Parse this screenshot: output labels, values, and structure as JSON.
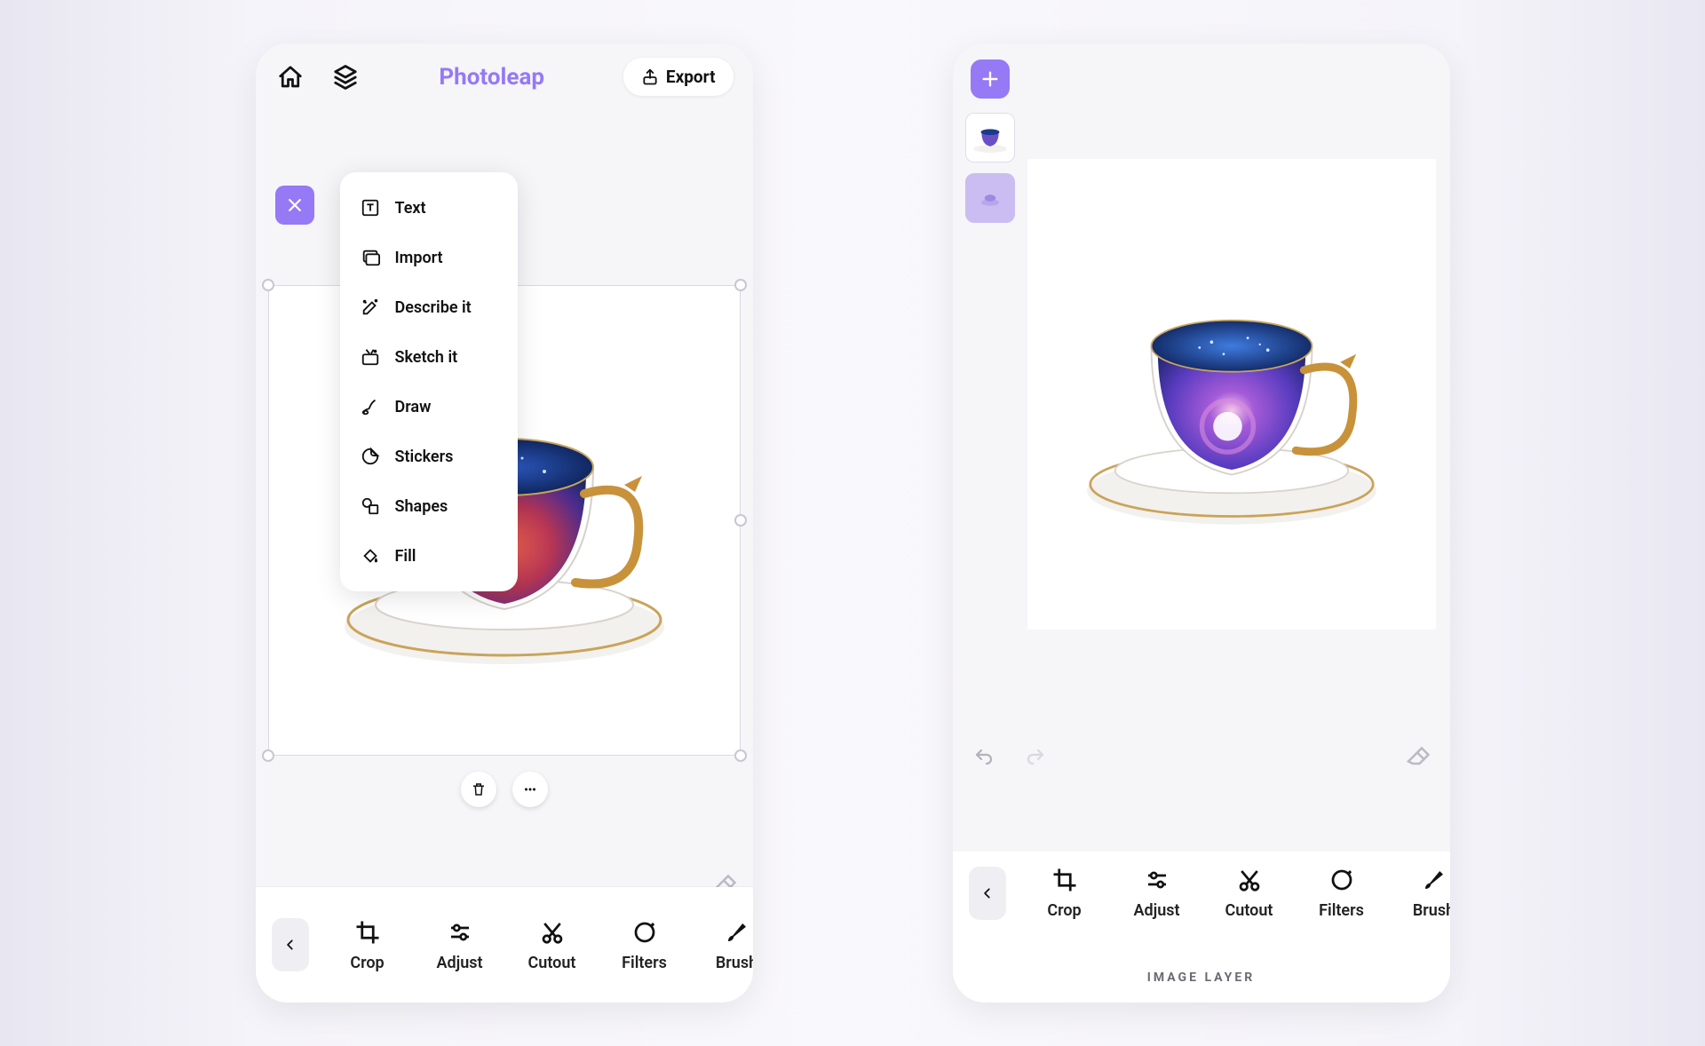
{
  "phone_a": {
    "brand": "Photoleap",
    "export_label": "Export",
    "menu": {
      "items": [
        {
          "label": "Text",
          "icon": "text-icon"
        },
        {
          "label": "Import",
          "icon": "import-icon"
        },
        {
          "label": "Describe it",
          "icon": "describe-icon"
        },
        {
          "label": "Sketch it",
          "icon": "sketch-icon"
        },
        {
          "label": "Draw",
          "icon": "draw-icon"
        },
        {
          "label": "Stickers",
          "icon": "stickers-icon"
        },
        {
          "label": "Shapes",
          "icon": "shapes-icon"
        },
        {
          "label": "Fill",
          "icon": "fill-icon"
        }
      ]
    },
    "tools": [
      {
        "label": "Crop"
      },
      {
        "label": "Adjust"
      },
      {
        "label": "Cutout"
      },
      {
        "label": "Filters"
      },
      {
        "label": "Brush"
      }
    ]
  },
  "phone_b": {
    "layer_caption": "IMAGE LAYER",
    "tools": [
      {
        "label": "Crop"
      },
      {
        "label": "Adjust"
      },
      {
        "label": "Cutout"
      },
      {
        "label": "Filters"
      },
      {
        "label": "Brush"
      }
    ]
  },
  "colors": {
    "accent": "#9579f5"
  }
}
